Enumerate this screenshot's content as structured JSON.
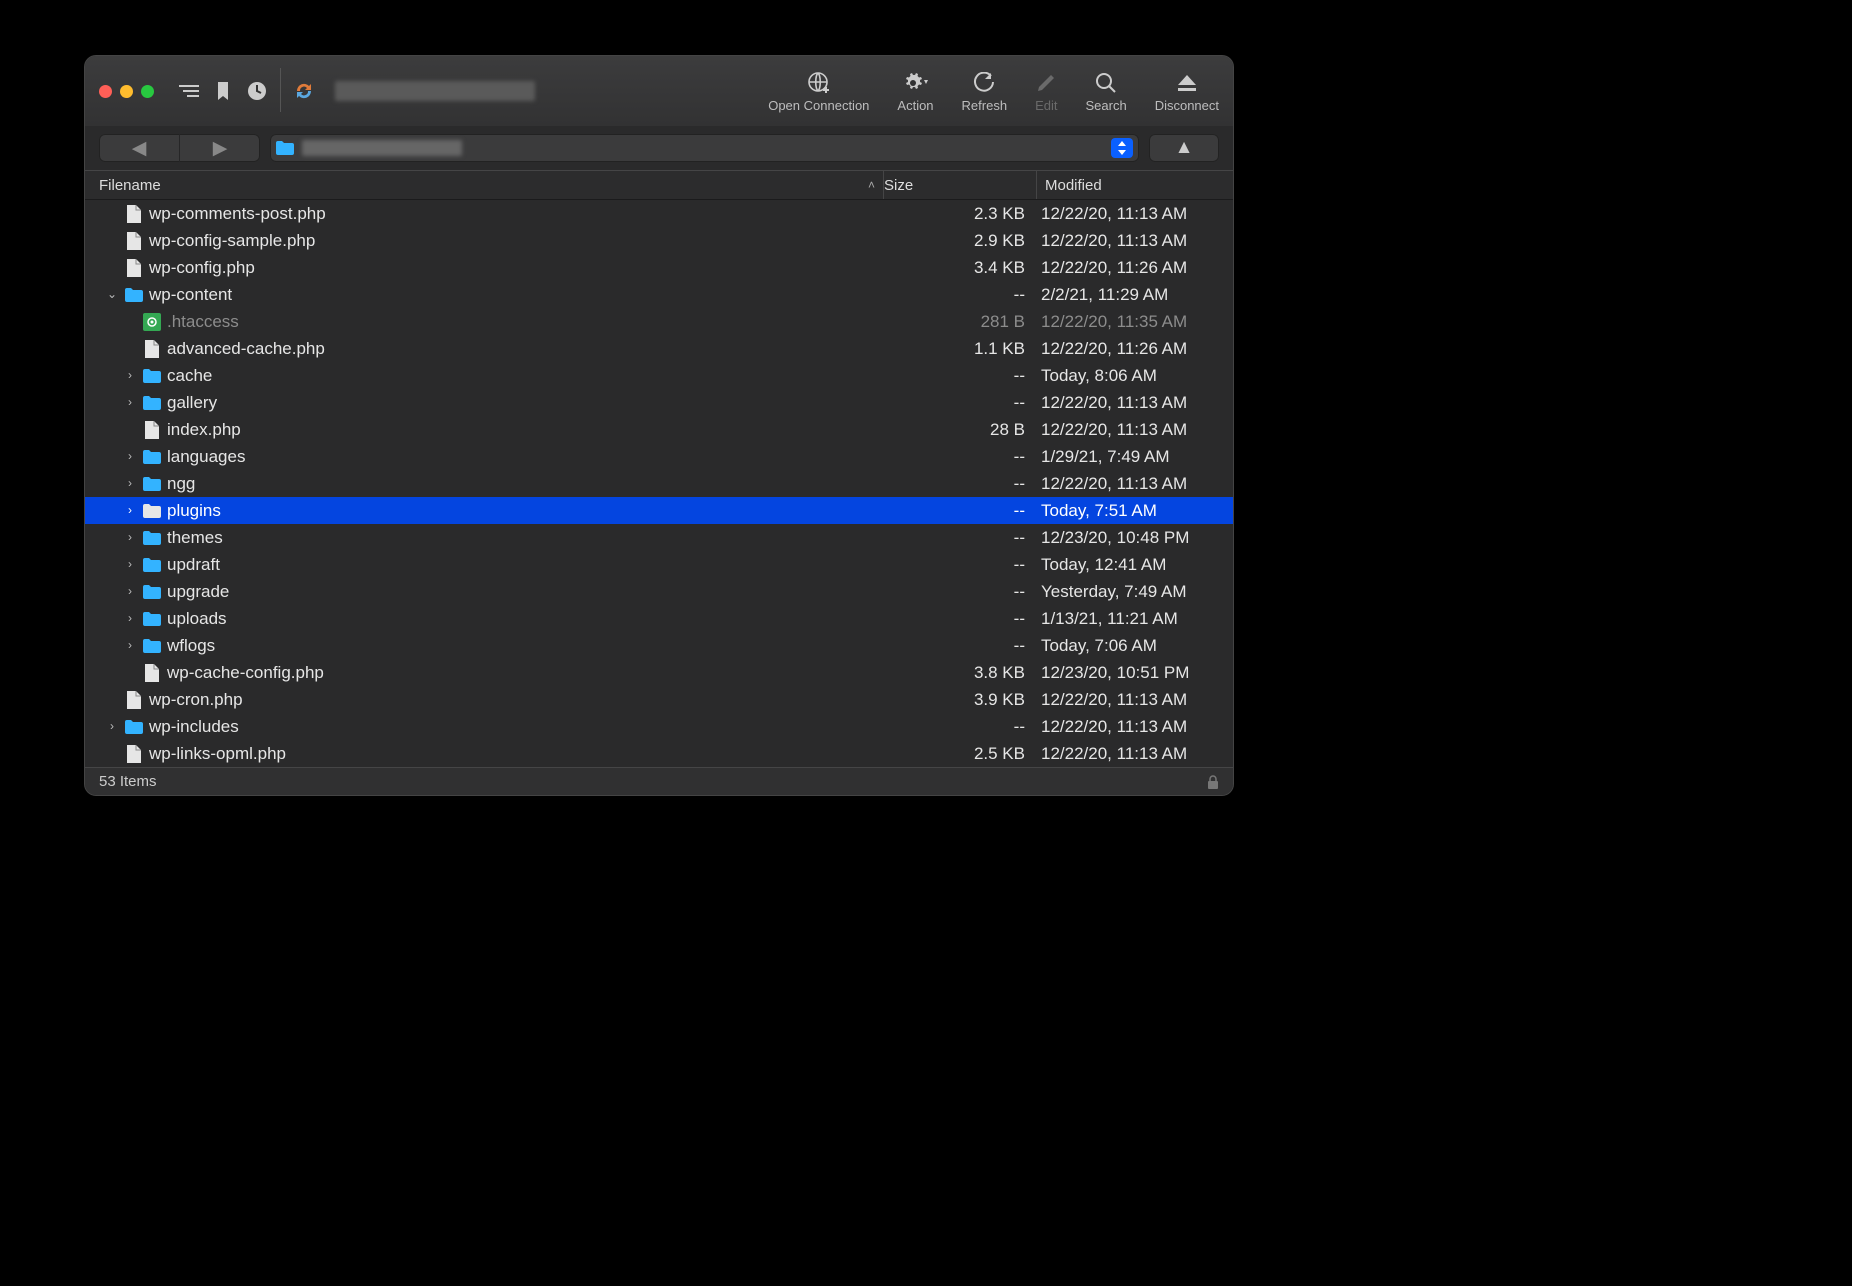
{
  "toolbar": {
    "open_connection": "Open Connection",
    "action": "Action",
    "refresh": "Refresh",
    "edit": "Edit",
    "search": "Search",
    "disconnect": "Disconnect"
  },
  "columns": {
    "filename": "Filename",
    "size": "Size",
    "modified": "Modified"
  },
  "rows": [
    {
      "depth": 1,
      "name": "wp-comments-post.php",
      "kind": "file",
      "size": "2.3 KB",
      "modified": "12/22/20, 11:13 AM"
    },
    {
      "depth": 1,
      "name": "wp-config-sample.php",
      "kind": "file",
      "size": "2.9 KB",
      "modified": "12/22/20, 11:13 AM"
    },
    {
      "depth": 1,
      "name": "wp-config.php",
      "kind": "file",
      "size": "3.4 KB",
      "modified": "12/22/20, 11:26 AM"
    },
    {
      "depth": 1,
      "name": "wp-content",
      "kind": "folder",
      "expanded": true,
      "size": "--",
      "modified": "2/2/21, 11:29 AM"
    },
    {
      "depth": 2,
      "name": ".htaccess",
      "kind": "htaccess",
      "size": "281 B",
      "modified": "12/22/20, 11:35 AM",
      "dim": true
    },
    {
      "depth": 2,
      "name": "advanced-cache.php",
      "kind": "file",
      "size": "1.1 KB",
      "modified": "12/22/20, 11:26 AM"
    },
    {
      "depth": 2,
      "name": "cache",
      "kind": "folder",
      "size": "--",
      "modified": "Today, 8:06 AM"
    },
    {
      "depth": 2,
      "name": "gallery",
      "kind": "folder",
      "size": "--",
      "modified": "12/22/20, 11:13 AM"
    },
    {
      "depth": 2,
      "name": "index.php",
      "kind": "file",
      "size": "28 B",
      "modified": "12/22/20, 11:13 AM"
    },
    {
      "depth": 2,
      "name": "languages",
      "kind": "folder",
      "size": "--",
      "modified": "1/29/21, 7:49 AM"
    },
    {
      "depth": 2,
      "name": "ngg",
      "kind": "folder",
      "size": "--",
      "modified": "12/22/20, 11:13 AM"
    },
    {
      "depth": 2,
      "name": "plugins",
      "kind": "folder",
      "size": "--",
      "modified": "Today, 7:51 AM",
      "selected": true
    },
    {
      "depth": 2,
      "name": "themes",
      "kind": "folder",
      "size": "--",
      "modified": "12/23/20, 10:48 PM"
    },
    {
      "depth": 2,
      "name": "updraft",
      "kind": "folder",
      "size": "--",
      "modified": "Today, 12:41 AM"
    },
    {
      "depth": 2,
      "name": "upgrade",
      "kind": "folder",
      "size": "--",
      "modified": "Yesterday, 7:49 AM"
    },
    {
      "depth": 2,
      "name": "uploads",
      "kind": "folder",
      "size": "--",
      "modified": "1/13/21, 11:21 AM"
    },
    {
      "depth": 2,
      "name": "wflogs",
      "kind": "folder",
      "size": "--",
      "modified": "Today, 7:06 AM"
    },
    {
      "depth": 2,
      "name": "wp-cache-config.php",
      "kind": "file",
      "size": "3.8 KB",
      "modified": "12/23/20, 10:51 PM"
    },
    {
      "depth": 1,
      "name": "wp-cron.php",
      "kind": "file",
      "size": "3.9 KB",
      "modified": "12/22/20, 11:13 AM"
    },
    {
      "depth": 1,
      "name": "wp-includes",
      "kind": "folder",
      "size": "--",
      "modified": "12/22/20, 11:13 AM"
    },
    {
      "depth": 1,
      "name": "wp-links-opml.php",
      "kind": "file",
      "size": "2.5 KB",
      "modified": "12/22/20, 11:13 AM"
    }
  ],
  "status": {
    "items": "53 Items"
  }
}
